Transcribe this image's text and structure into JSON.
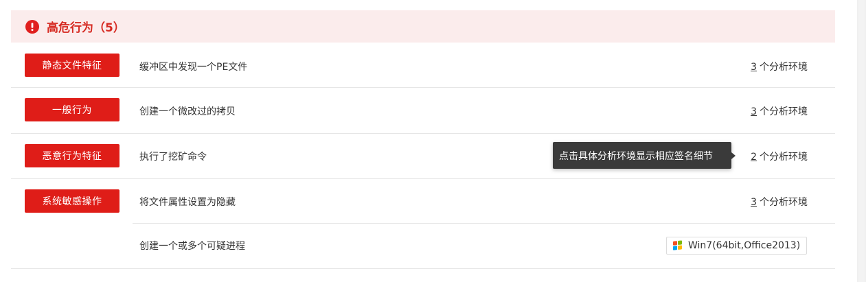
{
  "section": {
    "title": "高危行为（5）",
    "icon": "alert-icon",
    "accent_color": "#df1d18",
    "header_bg": "#fbecec"
  },
  "rows": [
    {
      "tag": "静态文件特征",
      "description": "缓冲区中发现一个PE文件",
      "env_count": "3",
      "env_label": "个分析环境"
    },
    {
      "tag": "一般行为",
      "description": "创建一个微改过的拷贝",
      "env_count": "3",
      "env_label": "个分析环境"
    },
    {
      "tag": "恶意行为特征",
      "description": "执行了挖矿命令",
      "env_count": "2",
      "env_label": "个分析环境"
    },
    {
      "tag": "系统敏感操作",
      "description": "将文件属性设置为隐藏",
      "env_count": "3",
      "env_label": "个分析环境"
    },
    {
      "tag": "",
      "description": "创建一个或多个可疑进程",
      "env_name": "Win7(64bit,Office2013)",
      "env_icon": "windows-icon"
    }
  ],
  "tooltip": {
    "text": "点击具体分析环境显示相应签名细节"
  }
}
